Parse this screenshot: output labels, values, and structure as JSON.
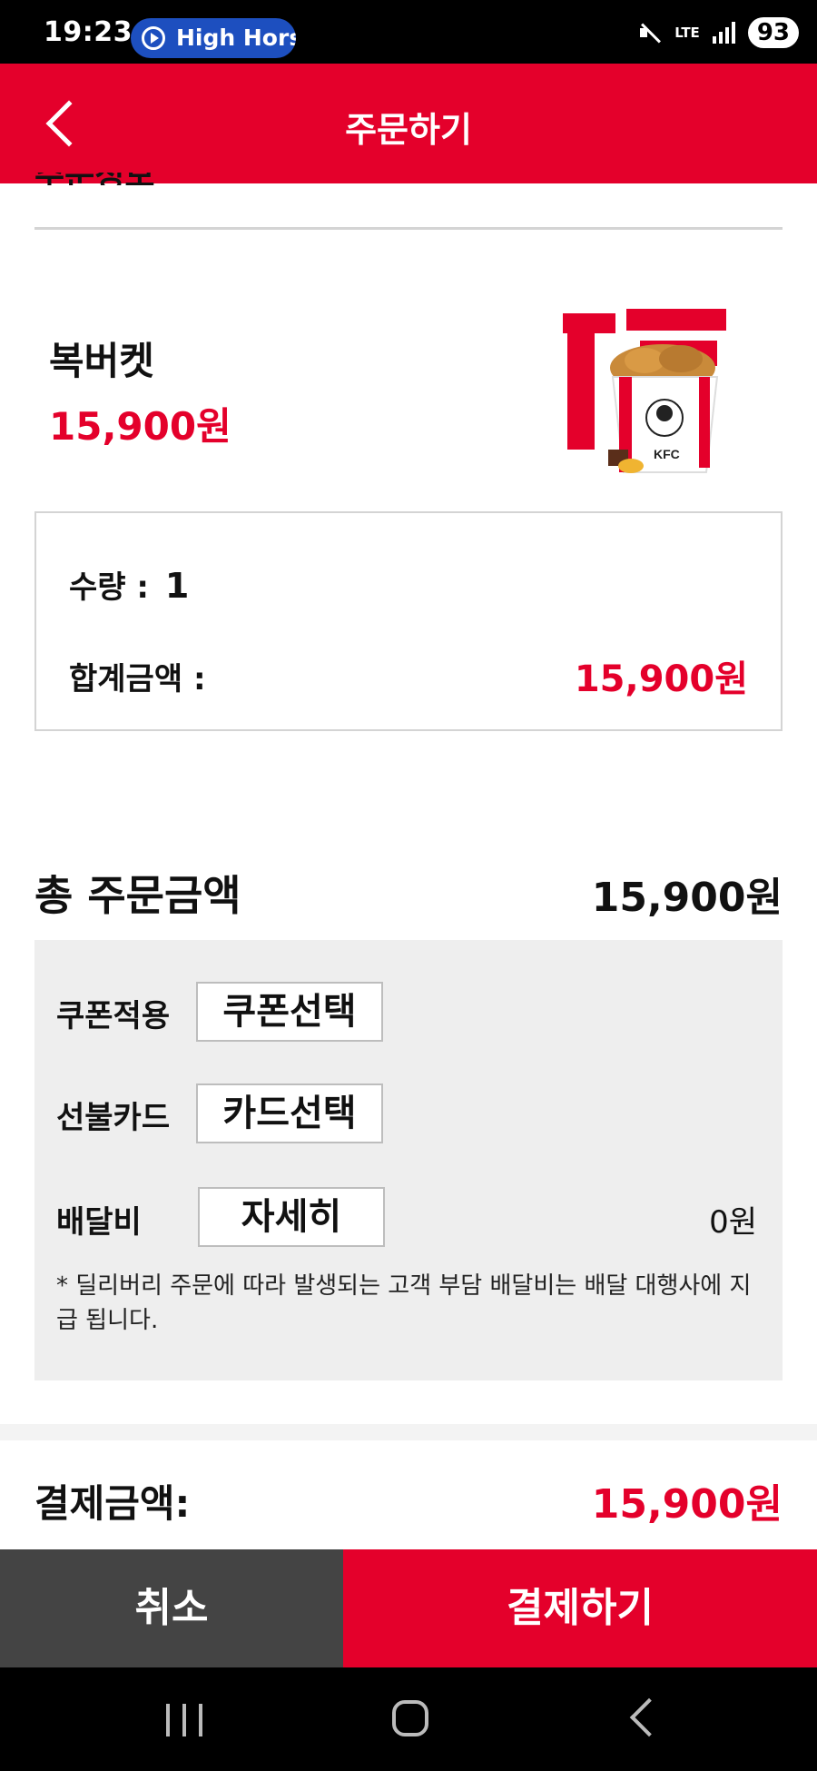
{
  "status_bar": {
    "time": "19:23",
    "media_pill_text": "High Hors",
    "network": "LTE",
    "battery": "93"
  },
  "header": {
    "title": "주문하기"
  },
  "section_heading_cut": "주문정보",
  "product": {
    "name": "복버켓",
    "price": "15,900원",
    "image_icon": "kfc-bucket-image"
  },
  "summary": {
    "qty_label": "수량 :",
    "qty_value": "1",
    "sum_label": "합계금액 :",
    "sum_value": "15,900원"
  },
  "total": {
    "label": "총 주문금액",
    "value": "15,900원"
  },
  "options": {
    "coupon_label": "쿠폰적용",
    "coupon_button": "쿠폰선택",
    "card_label": "선불카드",
    "card_button": "카드선택",
    "delivery_label": "배달비",
    "delivery_button": "자세히",
    "delivery_value": "0원",
    "notice": "* 딜리버리 주문에 따라 발생되는 고객 부담 배달비는 배달 대행사에 지급 됩니다."
  },
  "payment": {
    "label": "결제금액:",
    "value": "15,900원"
  },
  "buttons": {
    "cancel": "취소",
    "pay": "결제하기"
  },
  "colors": {
    "brand_red": "#e4002b",
    "cancel_gray": "#444444"
  }
}
